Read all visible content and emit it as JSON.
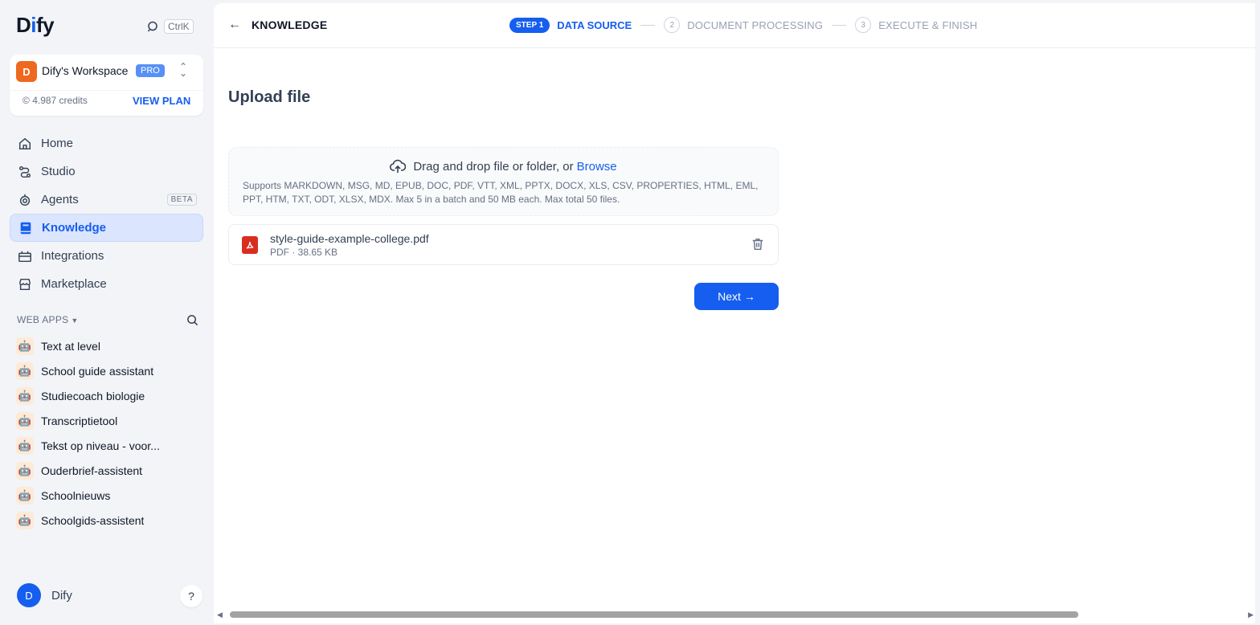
{
  "app": {
    "logo_prefix": "D",
    "logo_i": "i",
    "logo_suffix": "fy",
    "search_shortcut": "CtrlK"
  },
  "workspace": {
    "avatar_letter": "D",
    "name": "Dify's Workspace",
    "plan_badge": "PRO",
    "credits": "4.987 credits",
    "view_plan": "VIEW PLAN"
  },
  "nav": {
    "home": "Home",
    "studio": "Studio",
    "agents": "Agents",
    "agents_badge": "BETA",
    "knowledge": "Knowledge",
    "integrations": "Integrations",
    "marketplace": "Marketplace"
  },
  "webapps": {
    "title": "WEB APPS",
    "items": [
      "Text at level",
      "School guide assistant",
      "Studiecoach biologie",
      "Transcriptietool",
      "Tekst op niveau - voor...",
      "Ouderbrief-assistent",
      "Schoolnieuws",
      "Schoolgids-assistent"
    ]
  },
  "user": {
    "avatar_letter": "D",
    "name": "Dify",
    "help": "?"
  },
  "header": {
    "breadcrumb": "KNOWLEDGE",
    "step1_pill": "STEP 1",
    "step1_label": "DATA SOURCE",
    "step2_num": "2",
    "step2_label": "DOCUMENT PROCESSING",
    "step3_num": "3",
    "step3_label": "EXECUTE & FINISH"
  },
  "upload": {
    "title": "Upload file",
    "drop_text": "Drag and drop file or folder, or",
    "browse": "Browse",
    "supports": "Supports MARKDOWN, MSG, MD, EPUB, DOC, PDF, VTT, XML, PPTX, DOCX, XLS, CSV, PROPERTIES, HTML, EML, PPT, HTM, TXT, ODT, XLSX, MDX. Max 5 in a batch and 50 MB each. Max total 50 files."
  },
  "file": {
    "name": "style-guide-example-college.pdf",
    "meta": "PDF · 38.65 KB"
  },
  "actions": {
    "next": "Next →"
  },
  "colors": {
    "accent": "#155eef",
    "pdf": "#d92d20",
    "workspace_avatar": "#ef6820"
  }
}
